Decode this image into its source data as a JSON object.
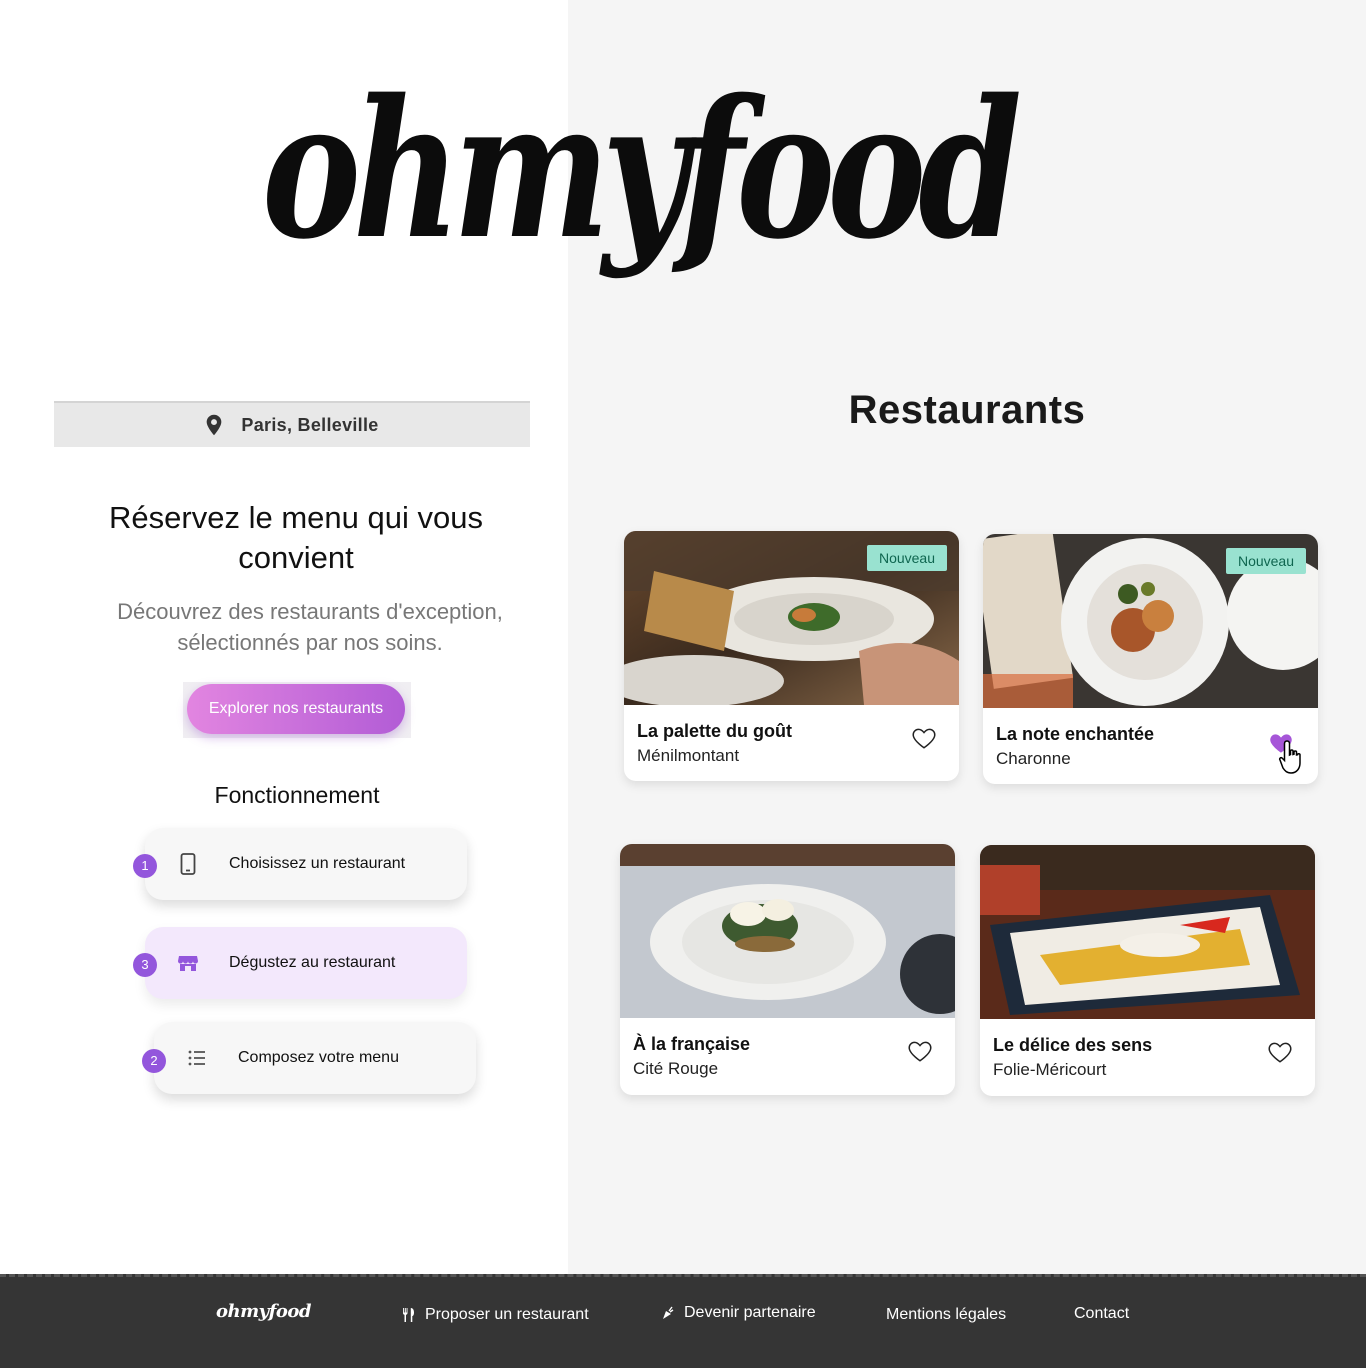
{
  "brand": {
    "logo_text": "ohmyfood"
  },
  "location": {
    "label": "Paris, Belleville",
    "icon": "location-pin-icon"
  },
  "hero": {
    "title": "Réservez le menu qui vous convient",
    "subtitle": "Découvrez des restaurants d'exception, sélectionnés par nos soins.",
    "cta_label": "Explorer nos restaurants"
  },
  "how_it_works": {
    "title": "Fonctionnement",
    "steps": [
      {
        "number": "1",
        "label": "Choisissez un restaurant",
        "icon": "smartphone-icon"
      },
      {
        "number": "3",
        "label": "Dégustez au restaurant",
        "icon": "storefront-icon"
      },
      {
        "number": "2",
        "label": "Composez votre menu",
        "icon": "list-icon"
      }
    ]
  },
  "restaurants": {
    "title": "Restaurants",
    "cards": [
      {
        "name": "La palette du goût",
        "area": "Ménilmontant",
        "badge": "Nouveau",
        "liked": false
      },
      {
        "name": "La note enchantée",
        "area": "Charonne",
        "badge": "Nouveau",
        "liked": true
      },
      {
        "name": "À la française",
        "area": "Cité Rouge",
        "badge": "",
        "liked": false
      },
      {
        "name": "Le délice des sens",
        "area": "Folie-Méricourt",
        "badge": "",
        "liked": false
      }
    ]
  },
  "footer": {
    "logo": "ohmyfood",
    "links": [
      {
        "label": "Proposer un restaurant",
        "icon": "fork-knife-icon"
      },
      {
        "label": "Devenir partenaire",
        "icon": "carrot-icon"
      },
      {
        "label": "Mentions légales"
      },
      {
        "label": "Contact"
      }
    ]
  },
  "colors": {
    "accent_purple": "#9356dc",
    "cta_gradient_start": "#e285e0",
    "cta_gradient_end": "#b25cd6",
    "badge_bg": "#99e2d0",
    "footer_bg": "#353535"
  }
}
